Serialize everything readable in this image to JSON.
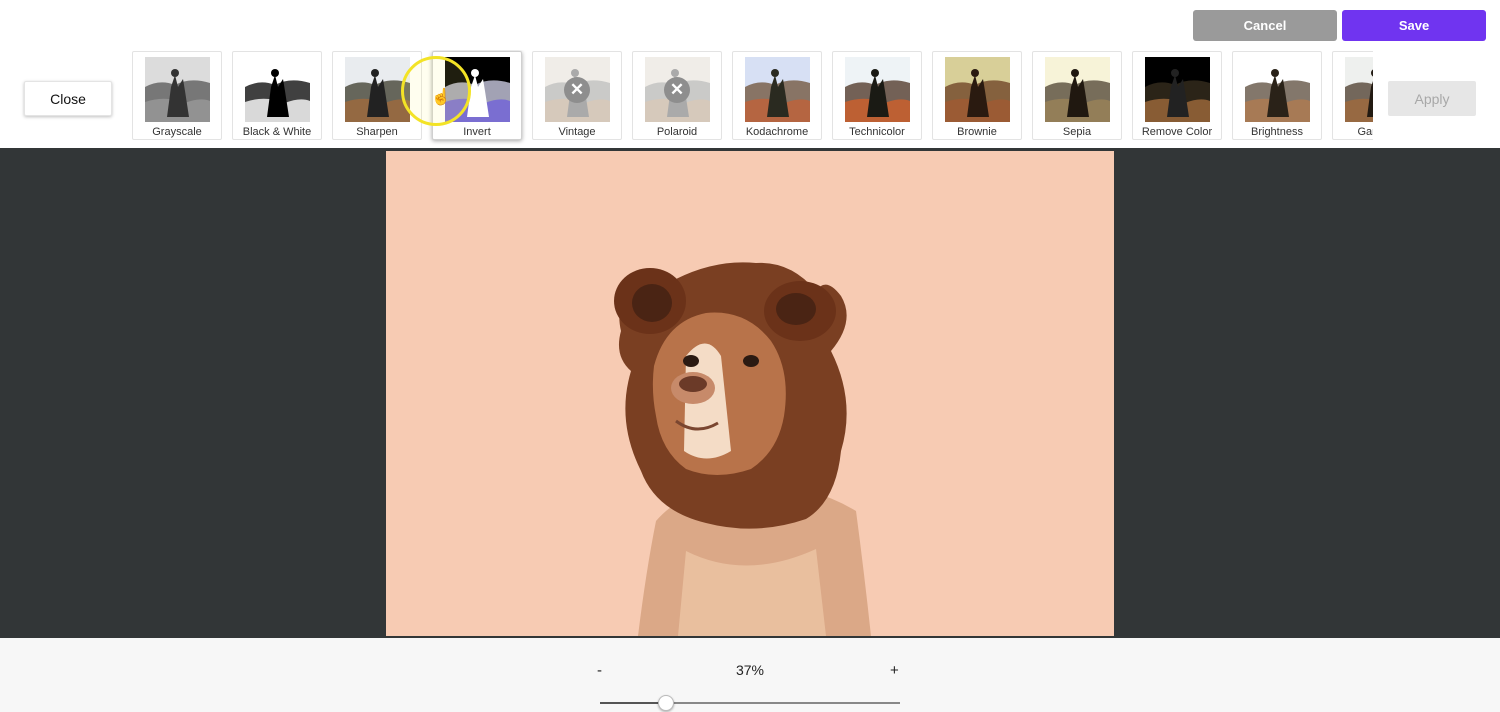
{
  "toolbar": {
    "cancel_label": "Cancel",
    "save_label": "Save",
    "close_label": "Close",
    "apply_label": "Apply"
  },
  "filters": [
    {
      "label": "Grayscale",
      "style": "grayscale"
    },
    {
      "label": "Black & White",
      "style": "bw"
    },
    {
      "label": "Sharpen",
      "style": "sharpen"
    },
    {
      "label": "Invert",
      "style": "invert",
      "active": true
    },
    {
      "label": "Vintage",
      "style": "disabled"
    },
    {
      "label": "Polaroid",
      "style": "disabled"
    },
    {
      "label": "Kodachrome",
      "style": "kodachrome"
    },
    {
      "label": "Technicolor",
      "style": "technicolor"
    },
    {
      "label": "Brownie",
      "style": "brownie"
    },
    {
      "label": "Sepia",
      "style": "sepia"
    },
    {
      "label": "Remove Color",
      "style": "removecolor"
    },
    {
      "label": "Brightness",
      "style": "brightness"
    },
    {
      "label": "Gamma",
      "style": "gamma"
    }
  ],
  "zoom": {
    "minus": "-",
    "plus": "+",
    "value_text": "37%",
    "slider_fraction": 0.22
  },
  "colors": {
    "save": "#7034f0",
    "cancel": "#9a9a9a",
    "canvas_background": "#f7cbb3",
    "workspace": "#323637"
  },
  "icons": {
    "disabled_filter": "close-circle-icon",
    "pointer": "hand-pointer-icon"
  }
}
